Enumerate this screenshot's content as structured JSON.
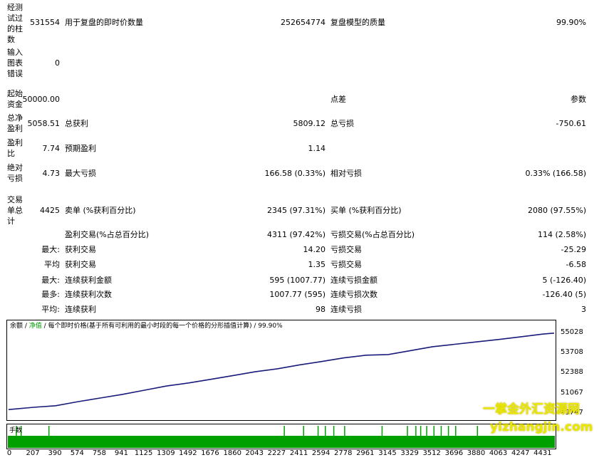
{
  "report": {
    "bars_tested_label": "经测试过的柱数",
    "bars_tested_value": "531554",
    "ticks_modelled_label": "用于复盘的即时价数量",
    "ticks_modelled_value": "252654774",
    "model_quality_label": "复盘模型的质量",
    "model_quality_value": "99.90%",
    "mismatched_errors_label": "输入图表错误",
    "mismatched_errors_value": "0",
    "initial_deposit_label": "起始资金",
    "initial_deposit_value": "50000.00",
    "spread_label": "点差",
    "spread_value": "参数",
    "total_net_profit_label": "总净盈利",
    "total_net_profit_value": "5058.51",
    "gross_profit_label": "总获利",
    "gross_profit_value": "5809.12",
    "gross_loss_label": "总亏损",
    "gross_loss_value": "-750.61",
    "profit_factor_label": "盈利比",
    "profit_factor_value": "7.74",
    "expected_payoff_label": "预期盈利",
    "expected_payoff_value": "1.14",
    "absolute_drawdown_label": "绝对亏损",
    "absolute_drawdown_value": "4.73",
    "maximal_drawdown_label": "最大亏损",
    "maximal_drawdown_value": "166.58 (0.33%)",
    "relative_drawdown_label": "相对亏损",
    "relative_drawdown_value": "0.33% (166.58)",
    "total_trades_label": "交易单总计",
    "total_trades_value": "4425",
    "short_positions_label": "卖单 (%获利百分比)",
    "short_positions_value": "2345 (97.31%)",
    "long_positions_label": "买单 (%获利百分比)",
    "long_positions_value": "2080 (97.55%)",
    "profit_trades_label": "盈利交易(%占总百分比)",
    "profit_trades_value": "4311 (97.42%)",
    "loss_trades_label": "亏损交易(%占总百分比)",
    "loss_trades_value": "114 (2.58%)",
    "largest_prefix": "最大:",
    "largest_profit_label": "获利交易",
    "largest_profit_value": "14.20",
    "largest_loss_label": "亏损交易",
    "largest_loss_value": "-25.29",
    "average_prefix": "平均",
    "average_profit_label": "获利交易",
    "average_profit_value": "1.35",
    "average_loss_label": "亏损交易",
    "average_loss_value": "-6.58",
    "maximum_prefix": "最大:",
    "max_consec_wins_label": "连续获利金额",
    "max_consec_wins_value": "595 (1007.77)",
    "max_consec_losses_label": "连续亏损金额",
    "max_consec_losses_value": "5 (-126.40)",
    "maximal_prefix": "最多:",
    "maximal_consec_profit_label": "连续获利次数",
    "maximal_consec_profit_value": "1007.77 (595)",
    "maximal_consec_loss_label": "连续亏损次数",
    "maximal_consec_loss_value": "-126.40 (5)",
    "avg_prefix": "平均:",
    "avg_consec_wins_label": "连续获利",
    "avg_consec_wins_value": "98",
    "avg_consec_losses_label": "连续亏损",
    "avg_consec_losses_value": "3"
  },
  "chart": {
    "legend_balance": "余额",
    "legend_sep1": " / ",
    "legend_equity": "净值",
    "legend_rest": " / 每个即时价格(基于所有可利用的最小时段的每一个价格的分形插值计算) / 99.90%",
    "volume_label": "手数",
    "line_color": "#1a1a7a",
    "volume_color": "#00a000"
  },
  "chart_data": {
    "type": "line",
    "x_ticks": [
      "0",
      "207",
      "390",
      "574",
      "758",
      "941",
      "1125",
      "1309",
      "1492",
      "1676",
      "1860",
      "2043",
      "2227",
      "2411",
      "2594",
      "2778",
      "2961",
      "3145",
      "3329",
      "3512",
      "3696",
      "3880",
      "4063",
      "4247",
      "4431"
    ],
    "y_ticks": [
      "55028",
      "53708",
      "52388",
      "51067",
      "49747"
    ],
    "ylim": [
      49747,
      55028
    ],
    "xlim": [
      0,
      4520
    ],
    "series": [
      {
        "x": [
          0,
          207,
          390,
          574,
          758,
          941,
          1125,
          1309,
          1492,
          1676,
          1860,
          2043,
          2227,
          2411,
          2594,
          2778,
          2961,
          3145,
          3329,
          3512,
          3696,
          3880,
          4063,
          4247,
          4431,
          4520
        ],
        "y": [
          50000,
          50150,
          50250,
          50520,
          50760,
          51000,
          51280,
          51560,
          51760,
          52000,
          52250,
          52500,
          52700,
          52960,
          53180,
          53420,
          53600,
          53640,
          53900,
          54160,
          54320,
          54480,
          54640,
          54820,
          55000,
          55060
        ]
      }
    ],
    "volume_spikes_x": [
      60,
      100,
      330,
      2280,
      2440,
      2560,
      2620,
      2690,
      2780,
      3090,
      3300,
      3370,
      3410,
      3460,
      3520,
      3580,
      3640,
      3700,
      3880
    ]
  }
}
